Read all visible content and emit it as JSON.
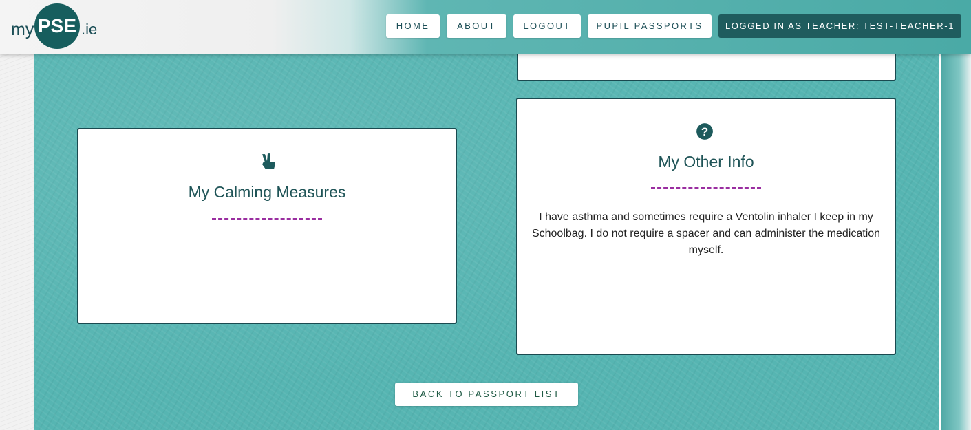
{
  "logo": {
    "prefix": "my",
    "main": "PSE",
    "suffix": ".ie"
  },
  "nav": {
    "home": "HOME",
    "about": "ABOUT",
    "logout": "LOGOUT",
    "pupil_passports": "PUPIL PASSPORTS",
    "user_status": "LOGGED IN AS TEACHER: TEST-TEACHER-1"
  },
  "cards": {
    "calming": {
      "icon": "peace-hand-icon",
      "title": "My Calming Measures",
      "divider": "---------------",
      "body": ""
    },
    "other": {
      "icon": "question-circle-icon",
      "title": "My Other Info",
      "divider": "---------------",
      "body": "I have asthma and sometimes require a Ventolin inhaler I keep in my Schoolbag. I do not require a spacer and can administer the medication myself."
    }
  },
  "back_button": "BACK TO PASSPORT LIST",
  "colors": {
    "accent": "#175e5e",
    "divider": "#9a2ea0",
    "panel": "#56b5b2"
  }
}
